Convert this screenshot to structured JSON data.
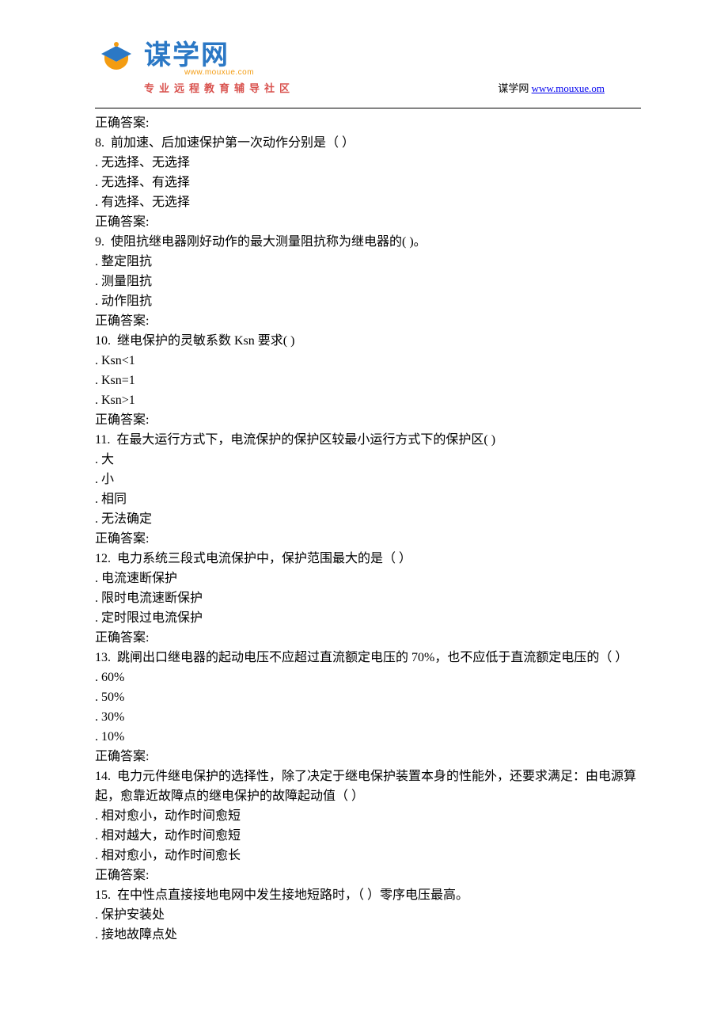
{
  "header": {
    "logo_title": "谋学网",
    "logo_url": "www.mouxue.com",
    "logo_tagline": "专业远程教育辅导社区",
    "right_label": "谋学网",
    "right_link": "www.mouxue.om"
  },
  "questions": [
    {
      "prefix_answer": "正确答案:",
      "number": "8.",
      "stem": "前加速、后加速保护第一次动作分别是（ ）",
      "options": [
        "无选择、无选择",
        "无选择、有选择",
        "有选择、无选择"
      ],
      "answer_label": "正确答案:"
    },
    {
      "number": "9.",
      "stem": "使阻抗继电器刚好动作的最大测量阻抗称为继电器的( )。",
      "options": [
        "整定阻抗",
        "测量阻抗",
        "动作阻抗"
      ],
      "answer_label": "正确答案:"
    },
    {
      "number": "10.",
      "stem": "继电保护的灵敏系数 Ksn 要求( )",
      "options": [
        "Ksn<1",
        "Ksn=1",
        "Ksn>1"
      ],
      "answer_label": "正确答案:"
    },
    {
      "number": "11.",
      "stem": "在最大运行方式下，电流保护的保护区较最小运行方式下的保护区( )",
      "options": [
        "大",
        "小",
        "相同",
        "无法确定"
      ],
      "answer_label": "正确答案:"
    },
    {
      "number": "12.",
      "stem": "电力系统三段式电流保护中，保护范围最大的是（ ）",
      "options": [
        "电流速断保护",
        "限时电流速断保护",
        "定时限过电流保护"
      ],
      "answer_label": "正确答案:"
    },
    {
      "number": "13.",
      "stem": "跳闸出口继电器的起动电压不应超过直流额定电压的 70%，也不应低于直流额定电压的（ ）",
      "options": [
        "60%",
        "50%",
        "30%",
        "10%"
      ],
      "answer_label": "正确答案:"
    },
    {
      "number": "14.",
      "stem": "电力元件继电保护的选择性，除了决定于继电保护装置本身的性能外，还要求满足：由电源算起，愈靠近故障点的继电保护的故障起动值（ ）",
      "options": [
        "相对愈小，动作时间愈短",
        "相对越大，动作时间愈短",
        "相对愈小，动作时间愈长"
      ],
      "answer_label": "正确答案:"
    },
    {
      "number": "15.",
      "stem": "在中性点直接接地电网中发生接地短路时，（ ）零序电压最高。",
      "options": [
        "保护安装处",
        "接地故障点处"
      ],
      "answer_label": ""
    }
  ]
}
